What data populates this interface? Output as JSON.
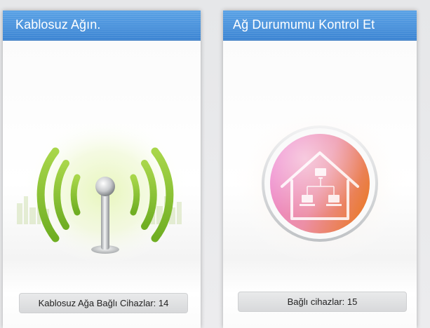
{
  "colors": {
    "header_blue": "#3c85d3",
    "signal_green": "#8cc63f",
    "network_pink": "#e97ac0",
    "network_orange": "#ea7a2c"
  },
  "wireless_card": {
    "title": "Kablosuz Ağın.",
    "icon": "wifi-antenna-icon",
    "stat_label": "Kablosuz Ağa Bağlı Cihazlar: 14"
  },
  "network_card": {
    "title": "Ağ Durumumu Kontrol Et",
    "icon": "home-network-icon",
    "stat_label": "Bağlı cihazlar: 15"
  }
}
